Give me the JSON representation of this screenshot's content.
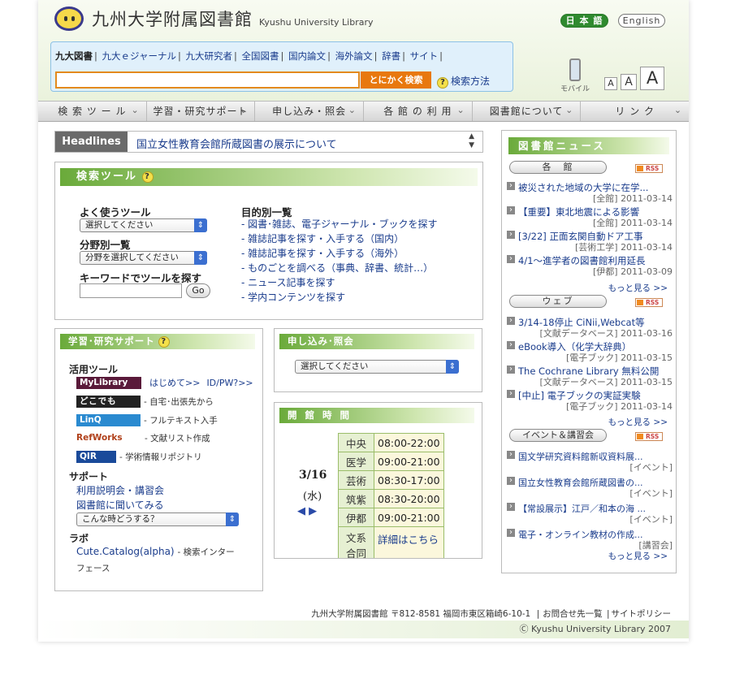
{
  "header": {
    "logo_ja": "九州大学附属図書館",
    "logo_en": "Kyushu University Library",
    "lang_ja": "日 本 語",
    "lang_en": "English",
    "scope": [
      "九大図書",
      "九大ｅジャーナル",
      "九大研究者",
      "全国図書",
      "国内論文",
      "海外論文",
      "辞書",
      "サイト"
    ],
    "search_button": "とにかく検索",
    "search_help": "検索方法",
    "mobile": "モバイル",
    "font_small": "A",
    "font_medium": "A",
    "font_large": "A"
  },
  "nav": [
    "検 索 ツ ー ル",
    "学習・研究サポート",
    "申し込み・照会",
    "各 館 の 利 用",
    "図書館について",
    "リ ン ク"
  ],
  "headlines": {
    "label": "Headlines",
    "text": "国立女性教育会館所蔵図書の展示について"
  },
  "search_tools": {
    "title": "検索ツール",
    "common_label": "よく使うツール",
    "common_select": "選択してください",
    "field_label": "分野別一覧",
    "field_select": "分野を選択してください",
    "keyword_label": "キーワードでツールを探す",
    "go": "Go",
    "purpose_label": "目的別一覧",
    "purpose": [
      "- 図書･雑誌、電子ジャーナル・ブックを探す",
      "- 雑誌記事を探す・入手する（国内）",
      "- 雑誌記事を探す・入手する（海外）",
      "- ものごとを調べる（事典、辞書、統計…）",
      "- ニュース記事を探す",
      "- 学内コンテンツを探す"
    ]
  },
  "support": {
    "title": "学習･研究サポート",
    "tools_label": "活用ツール",
    "mylibrary": "MyLibrary",
    "mylibrary_first": "はじめて>>",
    "mylibrary_id": "ID/PW?>>",
    "dokodemo": "どこでも",
    "dokodemo_desc": "- 自宅･出張先から",
    "linq": "LinQ",
    "linq_desc": "- フルテキスト入手",
    "refworks": "RefWorks",
    "refworks_desc": "- 文献リスト作成",
    "qir": "QIR",
    "qir_desc": "- 学術情報リポジトリ",
    "support_label": "サポート",
    "support_links": [
      "利用説明会・講習会",
      "図書館に聞いてみる"
    ],
    "support_select": "こんな時どうする？",
    "labo_label": "ラボ",
    "cute": "Cute.Catalog(alpha)",
    "cute_desc1": "- 検索インター",
    "cute_desc2": "フェース"
  },
  "apply": {
    "title": "申し込み･照会",
    "select": "選択してください"
  },
  "hours": {
    "title": "開 館 時 間",
    "date": "3/16",
    "weekday": "(水)",
    "rows": [
      {
        "name": "中央",
        "time": "08:00-22:00"
      },
      {
        "name": "医学",
        "time": "09:00-21:00"
      },
      {
        "name": "芸術",
        "time": "08:30-17:00"
      },
      {
        "name": "筑紫",
        "time": "08:30-20:00"
      },
      {
        "name": "伊都",
        "time": "09:00-21:00"
      },
      {
        "name": "文系合同",
        "time": "詳細はこちら"
      }
    ]
  },
  "news": {
    "title": "図書館ニュース",
    "rss": "RSS",
    "more": "もっと見る >>",
    "sections": [
      {
        "label": "各　館",
        "items": [
          {
            "title": "被災された地域の大学に在学...",
            "meta": "[全館] 2011-03-14"
          },
          {
            "title": "【重要】東北地震による影響",
            "meta": "[全館] 2011-03-14"
          },
          {
            "title": "[3/22] 正面玄関自動ドア工事",
            "meta": "[芸術工学] 2011-03-14"
          },
          {
            "title": "4/1〜進学者の図書館利用延長",
            "meta": "[伊都] 2011-03-09"
          }
        ]
      },
      {
        "label": "ウェブ",
        "items": [
          {
            "title": "3/14-18停止 CiNii,Webcat等",
            "meta": "[文献データベース] 2011-03-16"
          },
          {
            "title": "eBook導入（化学大辞典）",
            "meta": "[電子ブック] 2011-03-15"
          },
          {
            "title": "The Cochrane Library 無料公開",
            "meta": "[文献データベース] 2011-03-15"
          },
          {
            "title": "[中止] 電子ブックの実証実験",
            "meta": "[電子ブック] 2011-03-14"
          }
        ]
      },
      {
        "label": "イベント＆講習会",
        "items": [
          {
            "title": "国文学研究資料館新収資料展...",
            "meta": "[イベント]"
          },
          {
            "title": "国立女性教育会館所蔵図書の...",
            "meta": "[イベント]"
          },
          {
            "title": "【常設展示】江戸／和本の海 ...",
            "meta": "[イベント]"
          },
          {
            "title": "電子・オンライン教材の作成...",
            "meta": "[講習会]"
          }
        ]
      }
    ]
  },
  "footer": {
    "address": "九州大学附属図書館 〒812-8581 福岡市東区箱崎6-10-1",
    "contact": "お問合せ先一覧",
    "policy": "サイトポリシー",
    "copyright": "Ⓒ Kyushu University Library 2007"
  }
}
